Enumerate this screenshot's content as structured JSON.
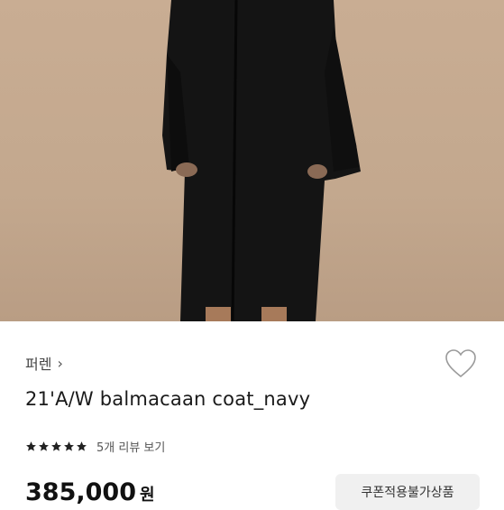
{
  "brand": {
    "name": "퍼렌"
  },
  "product": {
    "title": "21'A/W balmacaan coat_navy",
    "rating": 5,
    "review_link": "5개 리뷰 보기",
    "price": "385,000",
    "currency": "원",
    "coupon_label": "쿠폰적용불가상품"
  },
  "colors": {
    "star": "#222222",
    "coat": "#141414",
    "backdrop": "#c6ab91"
  }
}
